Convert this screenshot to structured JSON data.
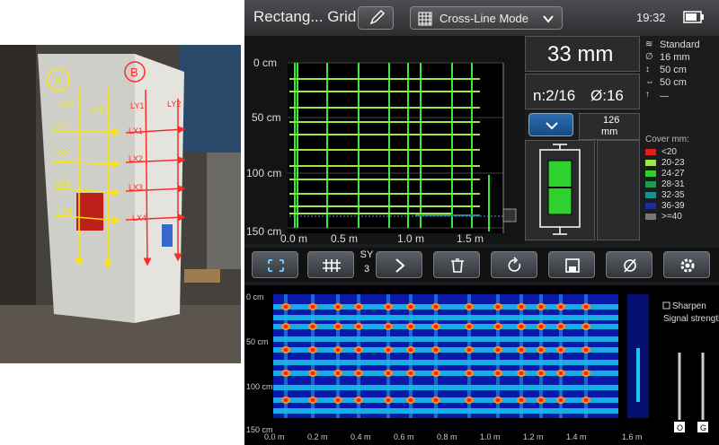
{
  "photo": {
    "labels": {
      "a": "A",
      "b": "B",
      "ly1_left": "LY1",
      "ly2_left": "LY2",
      "ly1_right": "LY1",
      "ly2_right": "LY2",
      "lx": [
        "LX1",
        "LX2",
        "LX3",
        "LX4"
      ]
    }
  },
  "header": {
    "title": "Rectang... Grid",
    "mode": "Cross-Line Mode",
    "time": "19:32"
  },
  "readout": {
    "depth": "33 mm",
    "count": "n:2/16",
    "diameter": "Ø:16",
    "cover_value": "126",
    "cover_unit": "mm"
  },
  "settings": {
    "profile": "Standard",
    "diameter": "16 mm",
    "spacing_v": "50 cm",
    "spacing_h": "50 cm",
    "dash": "—"
  },
  "legend": {
    "title": "Cover mm:",
    "items": [
      {
        "label": "<20",
        "color": "#e21b1b"
      },
      {
        "label": "20-23",
        "color": "#9be64a"
      },
      {
        "label": "24-27",
        "color": "#2fd12f"
      },
      {
        "label": "28-31",
        "color": "#1f9c48"
      },
      {
        "label": "32-35",
        "color": "#1e8e8e"
      },
      {
        "label": "36-39",
        "color": "#1a2e9c"
      },
      {
        "label": ">=40",
        "color": "#777777"
      }
    ]
  },
  "toolbar": {
    "sy_label": "SY",
    "sy_value": "3"
  },
  "top_axis": {
    "y": [
      "0 cm",
      "50 cm",
      "100 cm",
      "150 cm"
    ],
    "x": [
      "0.0 m",
      "0.5 m",
      "1.0 m",
      "1.5 m"
    ]
  },
  "bottom_axis": {
    "y": [
      "0 cm",
      "50 cm",
      "100 cm",
      "150 cm"
    ],
    "x": [
      "0.0 m",
      "0.2 m",
      "0.4 m",
      "0.6 m",
      "0.8 m",
      "1.0 m",
      "1.2 m",
      "1.4 m",
      "1.6 m"
    ]
  },
  "signal": {
    "sharpen": "Sharpen",
    "strength": "Signal strength",
    "o": "O",
    "g": "G"
  }
}
